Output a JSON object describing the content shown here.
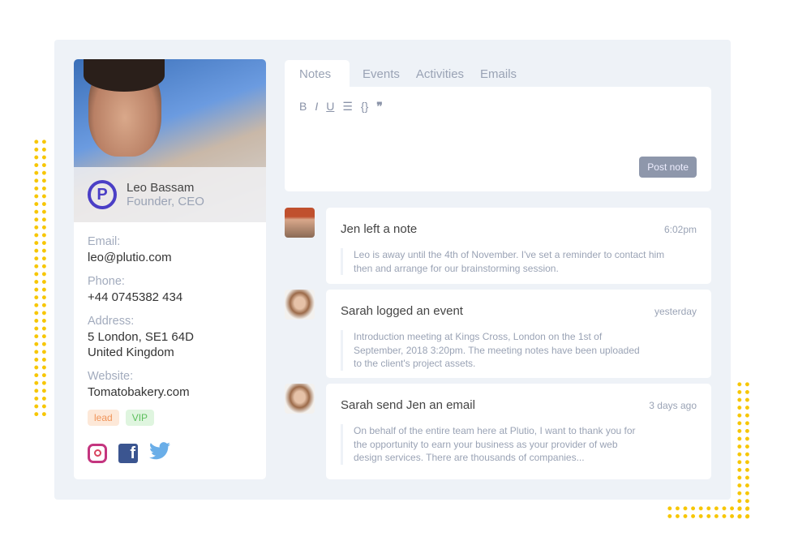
{
  "profile": {
    "name": "Leo Bassam",
    "role": "Founder, CEO",
    "logo_letter": "P",
    "fields": [
      {
        "label": "Email:",
        "value": "leo@plutio.com"
      },
      {
        "label": "Phone:",
        "value": "+44 0745382 434"
      },
      {
        "label": "Address:",
        "value": "5 London, SE1 64D\nUnited Kingdom"
      },
      {
        "label": "Website:",
        "value": "Tomatobakery.com"
      }
    ],
    "tags": [
      {
        "label": "lead",
        "bg": "#fde8d8",
        "color": "#f0955a"
      },
      {
        "label": "VIP",
        "bg": "#dff5df",
        "color": "#5cbf5c"
      }
    ],
    "social": [
      "instagram-icon",
      "facebook-icon",
      "twitter-icon"
    ]
  },
  "tabs": [
    "Notes",
    "Events",
    "Activities",
    "Emails"
  ],
  "editor": {
    "tools": [
      "B",
      "I",
      "U",
      "☰",
      "{}",
      "❞"
    ],
    "post_label": "Post note"
  },
  "feed": [
    {
      "title": "Jen left a note",
      "time": "6:02pm",
      "body": "Leo is away until the 4th of November. I've set a reminder to contact him then and arrange for our brainstorming session."
    },
    {
      "title": "Sarah logged an event",
      "time": "yesterday",
      "body": "Introduction meeting at Kings Cross, London on the 1st of September, 2018 3:20pm. The meeting notes have been uploaded to the client's project assets."
    },
    {
      "title": "Sarah send Jen an email",
      "time": "3 days ago",
      "body": "On behalf of the entire team here at Plutio, I want to thank you for the opportunity to earn your business as your provider of web design services. There are thousands of companies..."
    }
  ],
  "colors": {
    "accent": "#4b3fc6",
    "dots": "#f7c600",
    "panel": "#eef2f7"
  }
}
